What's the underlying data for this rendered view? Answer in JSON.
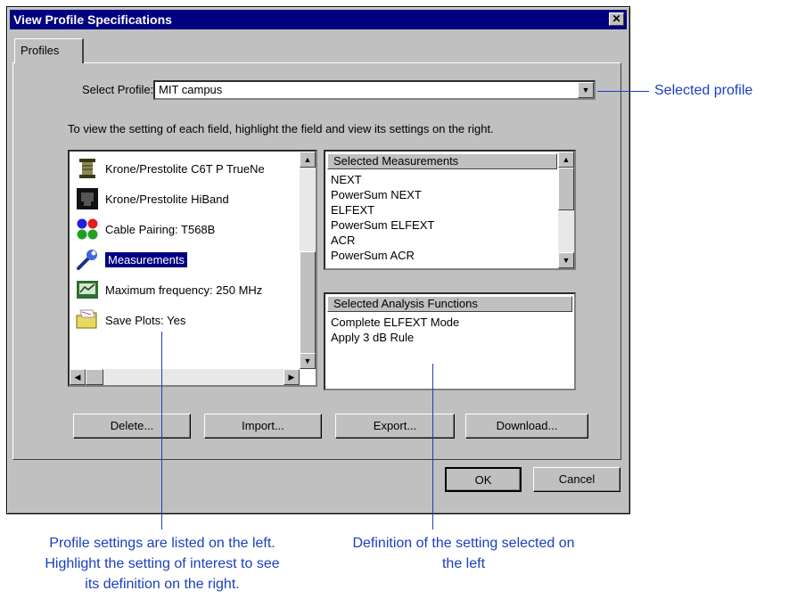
{
  "dialog": {
    "title": "View Profile Specifications",
    "close_glyph": "✕",
    "tab_label": "Profiles",
    "select_profile_label": "Select Profile:",
    "selected_profile": "MIT campus",
    "instructions": "To view the setting of each field, highlight the field and view its settings on the right.",
    "settings": [
      {
        "label": "Krone/Prestolite C6T P TrueNe",
        "icon": "spool-icon"
      },
      {
        "label": "Krone/Prestolite HiBand",
        "icon": "connector-jack-icon"
      },
      {
        "label": "Cable Pairing: T568B",
        "icon": "cable-pairing-dots-icon"
      },
      {
        "label": "Measurements",
        "icon": "wrench-icon",
        "selected": true
      },
      {
        "label": "Maximum frequency: 250 MHz",
        "icon": "frequency-meter-icon"
      },
      {
        "label": "Save Plots: Yes",
        "icon": "folder-icon"
      }
    ],
    "measurements": {
      "header": "Selected Measurements",
      "items": [
        "NEXT",
        "PowerSum NEXT",
        "ELFEXT",
        "PowerSum ELFEXT",
        "ACR",
        "PowerSum ACR"
      ]
    },
    "analysis": {
      "header": "Selected Analysis Functions",
      "items": [
        "Complete ELFEXT Mode",
        "Apply 3 dB Rule"
      ]
    },
    "buttons": {
      "delete": "Delete...",
      "import": "Import...",
      "export": "Export...",
      "download": "Download...",
      "ok": "OK",
      "cancel": "Cancel"
    }
  },
  "callouts": {
    "selected_profile": "Selected profile",
    "left": [
      "Profile settings are listed on the left.",
      "Highlight the setting of interest to see",
      "its definition on the right."
    ],
    "right": [
      "Definition of the setting selected on",
      "the left"
    ]
  },
  "colors": {
    "callout": "#1a3fbf",
    "titlebar": "#000080",
    "face": "#c0c0c0"
  }
}
